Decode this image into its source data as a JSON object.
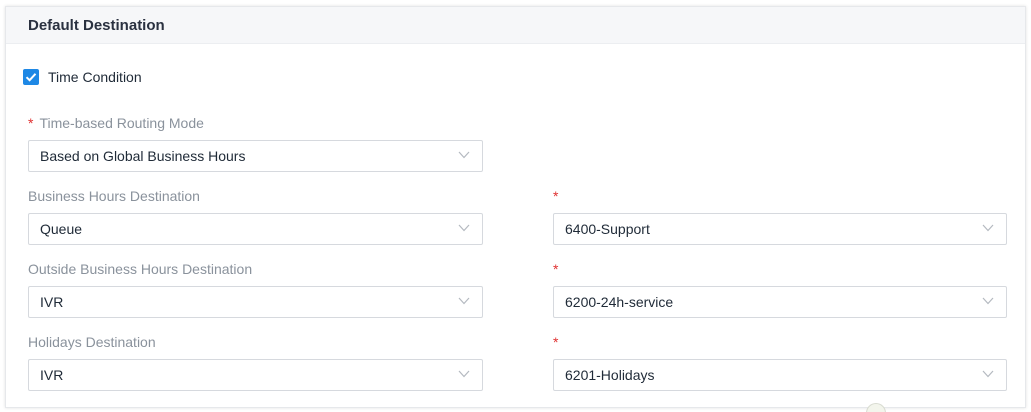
{
  "section": {
    "title": "Default Destination"
  },
  "time_condition": {
    "label": "Time Condition",
    "checked": true
  },
  "routing_mode": {
    "label": "Time-based Routing Mode",
    "required_mark": "*",
    "value": "Based on Global Business Hours"
  },
  "business_hours": {
    "label": "Business Hours Destination",
    "type_value": "Queue",
    "required_mark": "*",
    "target_value": "6400-Support"
  },
  "outside_hours": {
    "label": "Outside Business Hours Destination",
    "type_value": "IVR",
    "required_mark": "*",
    "target_value": "6200-24h-service"
  },
  "holidays": {
    "label": "Holidays Destination",
    "type_value": "IVR",
    "required_mark": "*",
    "target_value": "6201-Holidays"
  },
  "colors": {
    "accent": "#1e88e5",
    "required": "#e03131",
    "label": "#8a929c",
    "border": "#d6d9de"
  },
  "icons": {
    "checkbox": "checkmark-icon",
    "select": "chevron-down-icon"
  }
}
